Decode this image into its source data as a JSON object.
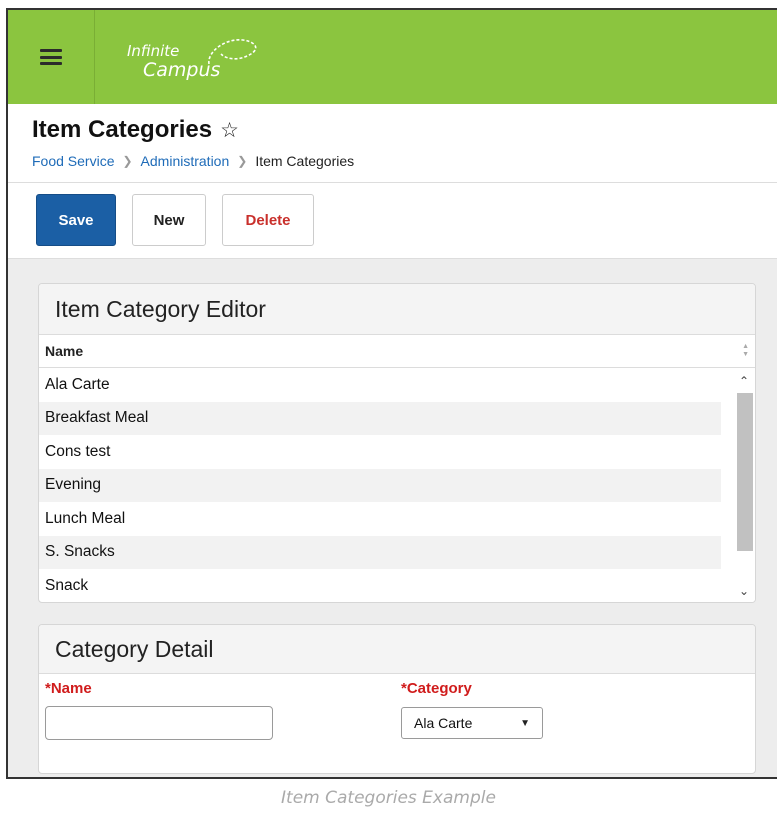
{
  "logo": {
    "line1": "Infinite",
    "line2": "Campus"
  },
  "header": {
    "title": "Item Categories",
    "breadcrumb": [
      "Food Service",
      "Administration",
      "Item Categories"
    ]
  },
  "toolbar": {
    "save": "Save",
    "new": "New",
    "delete": "Delete"
  },
  "editor": {
    "title": "Item Category Editor",
    "column": "Name",
    "rows": [
      "Ala Carte",
      "Breakfast Meal",
      "Cons test",
      "Evening",
      "Lunch Meal",
      "S. Snacks",
      "Snack"
    ]
  },
  "detail": {
    "title": "Category Detail",
    "name_label": "*Name",
    "name_value": "",
    "category_label": "*Category",
    "category_value": "Ala Carte"
  },
  "caption": "Item Categories Example",
  "colors": {
    "topbar": "#8bc53f",
    "save": "#1b5fa5",
    "link": "#1e6bb8",
    "required": "#d01c1c",
    "delete": "#c9302c"
  }
}
